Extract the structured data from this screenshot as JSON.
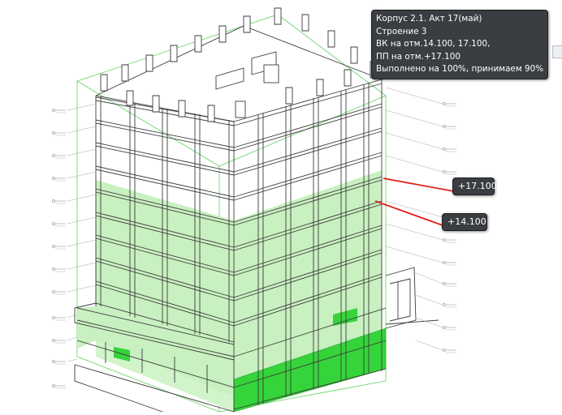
{
  "tooltip": {
    "lines": [
      "Корпус 2.1. Акт 17(май)",
      "Строение 3",
      "ВК на отм.14.100, 17.100,",
      "ПП на отм.+17.100",
      "Выполнено на 100%, принимаем 90%"
    ]
  },
  "elevation_tags": {
    "upper": "+17.100",
    "lower": "+14.100"
  },
  "colors": {
    "completed_fill": "#c8f0c0",
    "completed_solid": "#35d43a",
    "section_box": "#60d060",
    "marker_line": "#e0201c",
    "tooltip_bg": "#3a3d42"
  }
}
